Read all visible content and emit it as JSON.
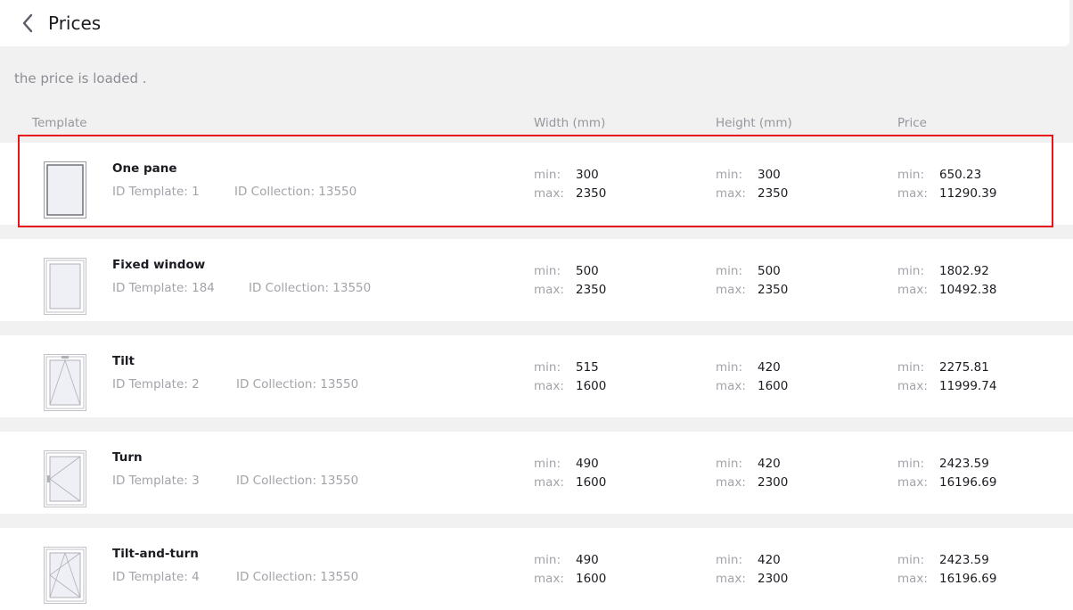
{
  "header": {
    "title": "Prices"
  },
  "status_text": "the price is loaded .",
  "columns": {
    "template": "Template",
    "width": "Width (mm)",
    "height": "Height (mm)",
    "price": "Price"
  },
  "labels": {
    "min": "min:",
    "max": "max:"
  },
  "rows": [
    {
      "name": "One pane",
      "id_template": "ID Template: 1",
      "id_collection": "ID Collection: 13550",
      "width_min": "300",
      "width_max": "2350",
      "height_min": "300",
      "height_max": "2350",
      "price_min": "650.23",
      "price_max": "11290.39",
      "icon": "one-pane-window-icon"
    },
    {
      "name": "Fixed window",
      "id_template": "ID Template: 184",
      "id_collection": "ID Collection: 13550",
      "width_min": "500",
      "width_max": "2350",
      "height_min": "500",
      "height_max": "2350",
      "price_min": "1802.92",
      "price_max": "10492.38",
      "icon": "fixed-window-icon"
    },
    {
      "name": "Tilt",
      "id_template": "ID Template: 2",
      "id_collection": "ID Collection: 13550",
      "width_min": "515",
      "width_max": "1600",
      "height_min": "420",
      "height_max": "1600",
      "price_min": "2275.81",
      "price_max": "11999.74",
      "icon": "tilt-window-icon"
    },
    {
      "name": "Turn",
      "id_template": "ID Template: 3",
      "id_collection": "ID Collection: 13550",
      "width_min": "490",
      "width_max": "1600",
      "height_min": "420",
      "height_max": "2300",
      "price_min": "2423.59",
      "price_max": "16196.69",
      "icon": "turn-window-icon"
    },
    {
      "name": "Tilt-and-turn",
      "id_template": "ID Template: 4",
      "id_collection": "ID Collection: 13550",
      "width_min": "490",
      "width_max": "1600",
      "height_min": "420",
      "height_max": "2300",
      "price_min": "2423.59",
      "price_max": "16196.69",
      "icon": "tilt-and-turn-window-icon"
    }
  ],
  "colors": {
    "highlight": "#e8141c",
    "background": "#f1f1f2"
  }
}
